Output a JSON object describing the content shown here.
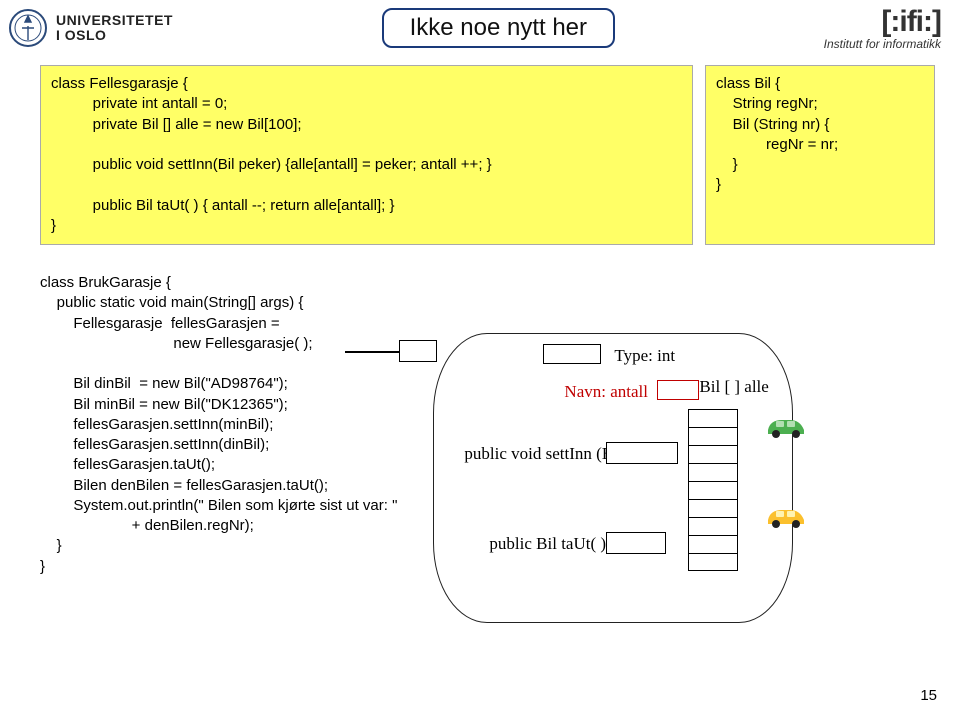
{
  "header": {
    "university_line1": "UNIVERSITETET",
    "university_line2": "I OSLO",
    "banner": "Ikke noe nytt her",
    "ifi_logo": "[:ifi:]",
    "ifi_sub": "Institutt for informatikk"
  },
  "code_fellesgarasje": "class Fellesgarasje {\n          private int antall = 0;\n          private Bil [] alle = new Bil[100];\n\n          public void settInn(Bil peker) {alle[antall] = peker; antall ++; }\n\n          public Bil taUt( ) { antall --; return alle[antall]; }\n}",
  "code_bil": "class Bil {\n    String regNr;\n    Bil (String nr) {\n            regNr = nr;\n    }\n}",
  "code_brukgarasje": "class BrukGarasje {\n    public static void main(String[] args) {\n        Fellesgarasje  fellesGarasjen =\n                                new Fellesgarasje( );\n\n        Bil dinBil  = new Bil(\"AD98764\");\n        Bil minBil = new Bil(\"DK12365\");\n        fellesGarasjen.settInn(minBil);\n        fellesGarasjen.settInn(dinBil);\n        fellesGarasjen.taUt();\n        Bilen denBilen = fellesGarasjen.taUt();\n        System.out.println(\" Bilen som kjørte sist ut var: \"\n                      + denBilen.regNr);\n    }\n}",
  "diagram": {
    "type_label": "Type: int",
    "name_label": "Navn: antall",
    "array_label": "Bil [ ] alle",
    "method1": "public void settInn (Bil  en)",
    "method2": "public Bil  taUt( )"
  },
  "page_number": "15"
}
